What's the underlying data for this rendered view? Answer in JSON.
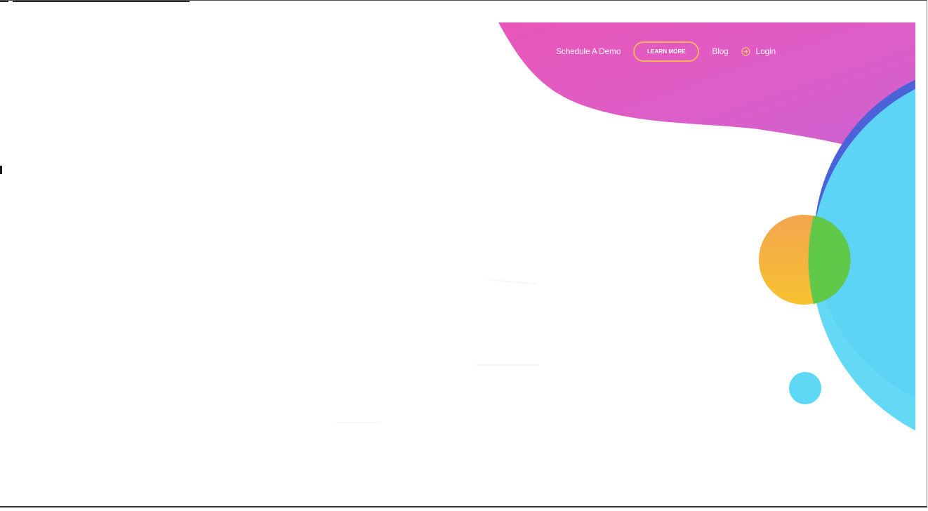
{
  "nav": {
    "schedule_demo": "Schedule A Demo",
    "learn_more": "LEARN MORE",
    "blog": "Blog",
    "login": "Login"
  },
  "icons": {
    "login": "login-arrow-icon"
  },
  "colors": {
    "magenta": "#e15bc2",
    "violet": "#c95fd0",
    "blue": "#4e64d9",
    "cyan": "#5dd7f4",
    "orange": "#f3a94c",
    "green": "#5cc94a",
    "button_border": "#f5b25e"
  }
}
